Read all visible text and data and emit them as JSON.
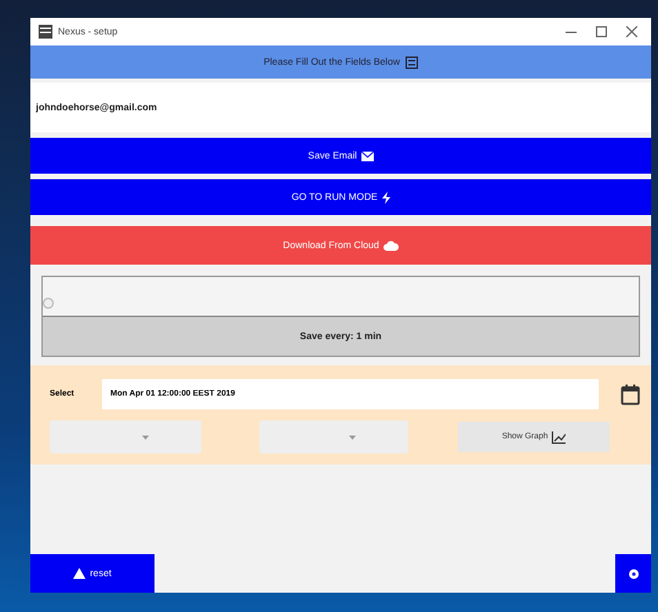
{
  "window": {
    "title": "Nexus - setup"
  },
  "header": {
    "text": "Please Fill Out the Fields Below"
  },
  "email_field": {
    "value": "johndoehorse@gmail.com"
  },
  "buttons": [
    {
      "label": "Save Email",
      "kind": "primary"
    },
    {
      "label": "GO TO RUN MODE",
      "kind": "primary"
    },
    {
      "label": "Download From Cloud",
      "kind": "danger"
    }
  ],
  "save_interval": {
    "level": 0,
    "label": "Save every: 1 min"
  },
  "date_picker": {
    "label": "Select",
    "value": "Mon Apr 01 12:00:00 EEST 2019"
  },
  "graph_button": {
    "label": "Show Graph"
  },
  "reset_button": {
    "label": "reset"
  }
}
